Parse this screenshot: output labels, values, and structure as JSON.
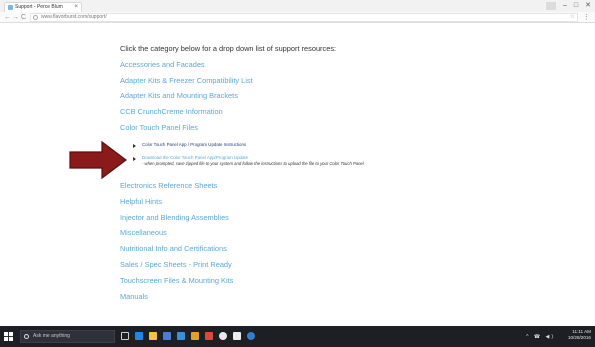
{
  "browser": {
    "tab_title": "Support - Perce Blum",
    "url": "www.flavorburst.com/support/",
    "close_glyph": "×",
    "back_glyph": "←",
    "forward_glyph": "→",
    "reload_glyph": "C",
    "star_glyph": "☆",
    "menu_glyph": "⋮",
    "minimize_glyph": "–",
    "restore_glyph": "□",
    "window_close_glyph": "✕"
  },
  "page": {
    "intro": "Click the category below for a drop down list of support resources:",
    "categories_top": [
      "Accessories and Facades",
      "Adapter Kits & Freezer Compatibility List",
      "Adapter Kits and Mounting Brackets",
      "CCB CrunchCreme Information",
      "Color Touch Panel Files"
    ],
    "subitems": [
      {
        "label": "Color Touch Panel App / Program Update Instructions",
        "color": "#1f3f7a"
      },
      {
        "label": "Download the Color Touch Panel App/Program Update",
        "color": "#5aa9d8",
        "note": "- when prompted, save zipped file to your system and follow the instructions to upload the file to your Color Touch Panel"
      }
    ],
    "categories_bottom": [
      "Electronics Reference Sheets",
      "Helpful Hints",
      "Injector and Blending Assemblies",
      "Miscellaneous",
      "Nutritional Info and Certifications",
      "Sales / Spec Sheets - Print Ready",
      "Touchscreen Files & Mounting Kits",
      "Manuals"
    ],
    "link_color": "#5aa9d8",
    "arrow_color": "#8b1a1a"
  },
  "taskbar": {
    "search_placeholder": "Ask me anything",
    "time": "11:11 AM",
    "date": "10/28/2016",
    "tray_glyphs": "^ ☎ ◀)"
  }
}
